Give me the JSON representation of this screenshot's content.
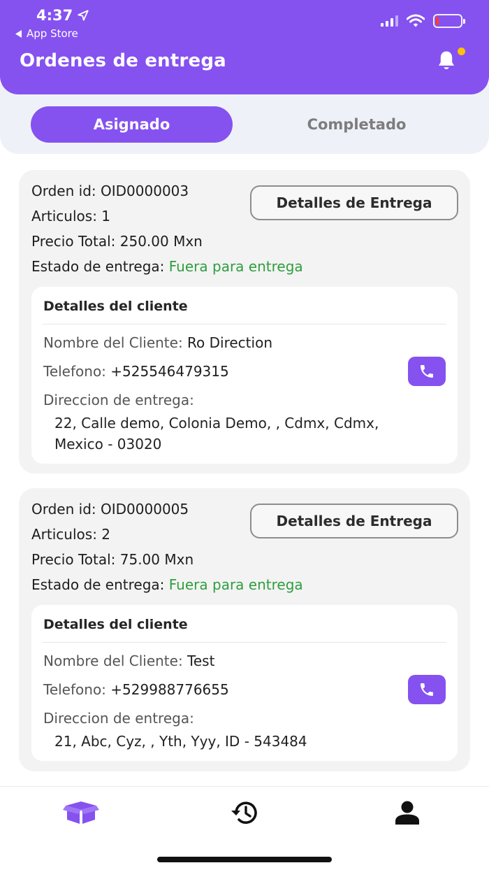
{
  "status_bar": {
    "time": "4:37",
    "back_label": "App Store"
  },
  "header": {
    "title": "Ordenes de entrega"
  },
  "tabs": {
    "assigned": "Asignado",
    "completed": "Completado"
  },
  "labels": {
    "order_id": "Orden id:",
    "items": "Articulos:",
    "total": "Precio Total:",
    "status": "Estado de entrega:",
    "details_button": "Detalles de Entrega",
    "client_title": "Detalles del cliente",
    "client_name": "Nombre del Cliente:",
    "phone": "Telefono:",
    "address": "Direccion de entrega:"
  },
  "orders": [
    {
      "id": "OID0000003",
      "items": "1",
      "total": "250.00 Mxn",
      "status": "Fuera para entrega",
      "client_name": "Ro Direction",
      "phone": "+525546479315",
      "address": "22, Calle demo, Colonia Demo, , Cdmx, Cdmx, Mexico - 03020"
    },
    {
      "id": "OID0000005",
      "items": "2",
      "total": "75.00 Mxn",
      "status": "Fuera para entrega",
      "client_name": "Test",
      "phone": "+529988776655",
      "address": "21, Abc, Cyz, , Yth, Yyy, ID - 543484"
    }
  ],
  "colors": {
    "primary": "#8552f0",
    "status_green": "#2e9e3f",
    "badge": "#ffc107"
  },
  "icons": {
    "nav": [
      "box-icon",
      "history-icon",
      "user-icon"
    ],
    "header": "bell-icon",
    "call": "phone-icon"
  }
}
